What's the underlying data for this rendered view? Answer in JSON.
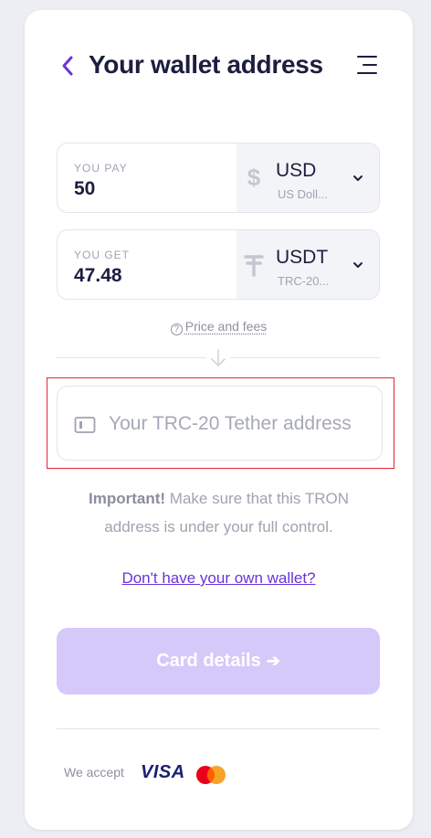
{
  "header": {
    "title": "Your wallet address"
  },
  "pay": {
    "label": "YOU PAY",
    "amount": "50",
    "currency_code": "USD",
    "currency_name": "US Doll..."
  },
  "get": {
    "label": "YOU GET",
    "amount": "47.48",
    "currency_code": "USDT",
    "currency_name": "TRC-20..."
  },
  "fees_link": "Price and fees",
  "wallet": {
    "placeholder": "Your TRC-20 Tether address",
    "value": ""
  },
  "notice": {
    "bold": "Important!",
    "text": " Make sure that this TRON address is under your full control."
  },
  "no_wallet_link": "Don't have your own wallet?",
  "cta": {
    "label": "Card details",
    "arrow": "➔"
  },
  "footer": {
    "accept_label": "We accept",
    "visa": "VISA"
  },
  "colors": {
    "accent": "#6a34d8",
    "cta_disabled": "#d5c9fa",
    "highlight": "#e0282e"
  }
}
